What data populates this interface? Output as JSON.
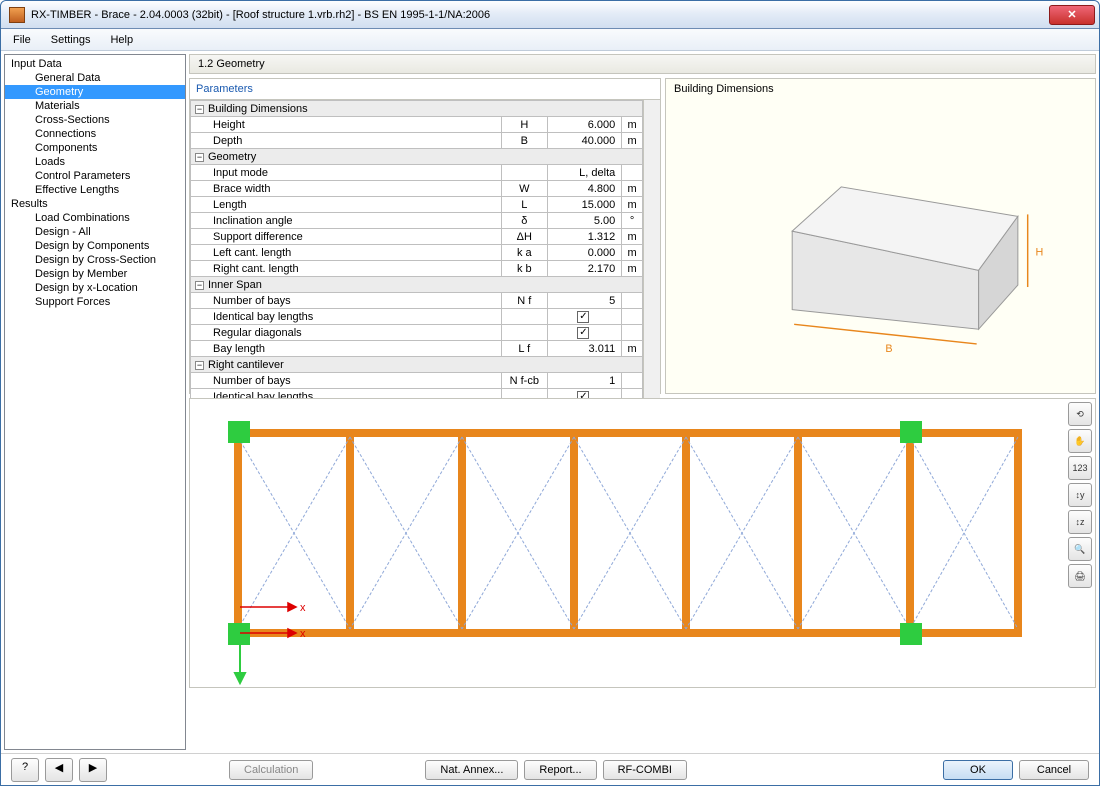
{
  "window": {
    "title": "RX-TIMBER - Brace - 2.04.0003 (32bit) - [Roof structure 1.vrb.rh2] - BS EN 1995-1-1/NA:2006"
  },
  "menu": {
    "file": "File",
    "settings": "Settings",
    "help": "Help"
  },
  "tree": {
    "g1": "Input Data",
    "g1_items": [
      "General Data",
      "Geometry",
      "Materials",
      "Cross-Sections",
      "Connections",
      "Components",
      "Loads",
      "Control Parameters",
      "Effective Lengths"
    ],
    "g2": "Results",
    "g2_items": [
      "Load Combinations",
      "Design - All",
      "Design by Components",
      "Design by Cross-Section",
      "Design by Member",
      "Design by x-Location",
      "Support Forces"
    ]
  },
  "heading": "1.2 Geometry",
  "param_head": "Parameters",
  "preview_title": "Building Dimensions",
  "grid": {
    "s1": "Building Dimensions",
    "r1": {
      "label": "Height",
      "sym": "H",
      "val": "6.000",
      "unit": "m"
    },
    "r2": {
      "label": "Depth",
      "sym": "B",
      "val": "40.000",
      "unit": "m"
    },
    "s2": "Geometry",
    "r3": {
      "label": "Input mode",
      "sym": "",
      "val": "L, delta",
      "unit": ""
    },
    "r4": {
      "label": "Brace width",
      "sym": "W",
      "val": "4.800",
      "unit": "m"
    },
    "r5": {
      "label": "Length",
      "sym": "L",
      "val": "15.000",
      "unit": "m"
    },
    "r6": {
      "label": "Inclination angle",
      "sym": "δ",
      "val": "5.00",
      "unit": "°"
    },
    "r7": {
      "label": "Support difference",
      "sym": "ΔH",
      "val": "1.312",
      "unit": "m"
    },
    "r8": {
      "label": "Left cant. length",
      "sym": "k a",
      "val": "0.000",
      "unit": "m"
    },
    "r9": {
      "label": "Right cant. length",
      "sym": "k b",
      "val": "2.170",
      "unit": "m"
    },
    "s3": "Inner Span",
    "r10": {
      "label": "Number of bays",
      "sym": "N f",
      "val": "5",
      "unit": ""
    },
    "r11": {
      "label": "Identical bay lengths",
      "sym": "",
      "chk": true
    },
    "r12": {
      "label": "Regular diagonals",
      "sym": "",
      "chk": true
    },
    "r13": {
      "label": "Bay length",
      "sym": "L f",
      "val": "3.011",
      "unit": "m"
    },
    "s4": "Right cantilever",
    "r14": {
      "label": "Number of bays",
      "sym": "N f-cb",
      "val": "1",
      "unit": ""
    },
    "r15": {
      "label": "Identical bay lengths",
      "sym": "",
      "chk": true
    }
  },
  "axis": {
    "x": "x"
  },
  "buttons": {
    "calc": "Calculation",
    "annex": "Nat. Annex...",
    "report": "Report...",
    "combi": "RF-COMBI",
    "ok": "OK",
    "cancel": "Cancel"
  }
}
